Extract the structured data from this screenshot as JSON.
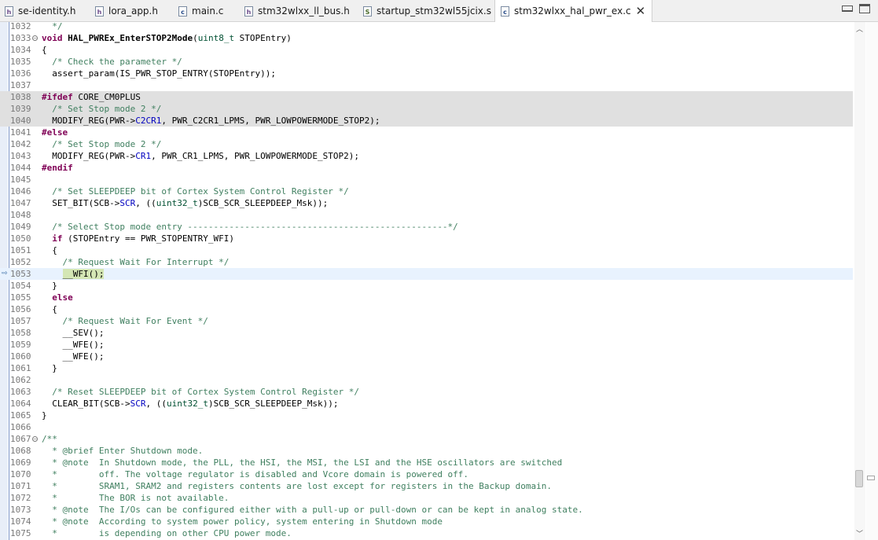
{
  "tabs": [
    {
      "label": "se-identity.h",
      "icon": "h-file-icon",
      "icon_glyph": "h"
    },
    {
      "label": "lora_app.h",
      "icon": "h-file-icon",
      "icon_glyph": "h"
    },
    {
      "label": "main.c",
      "icon": "c-file-icon",
      "icon_glyph": "c"
    },
    {
      "label": "stm32wlxx_ll_bus.h",
      "icon": "h-file-icon",
      "icon_glyph": "h"
    },
    {
      "label": "startup_stm32wl55jcix.s",
      "icon": "s-file-icon",
      "icon_glyph": "S"
    },
    {
      "label": "stm32wlxx_hal_pwr_ex.c",
      "icon": "c-file-icon",
      "icon_glyph": "c",
      "active": true
    }
  ],
  "window": {
    "close_glyph": "✕",
    "minimize_icon": "minimize-icon",
    "maximize_icon": "maximize-icon"
  },
  "lines": [
    {
      "n": "1032",
      "text": "  */"
    },
    {
      "n": "1033",
      "text": "void HAL_PWREx_EnterSTOP2Mode(uint8_t STOPEntry)",
      "fold": true
    },
    {
      "n": "1034",
      "text": "{"
    },
    {
      "n": "1035",
      "text": "  /* Check the parameter */"
    },
    {
      "n": "1036",
      "text": "  assert_param(IS_PWR_STOP_ENTRY(STOPEntry));"
    },
    {
      "n": "1037",
      "text": ""
    },
    {
      "n": "1038",
      "text": "#ifdef CORE_CM0PLUS"
    },
    {
      "n": "1039",
      "text": "  /* Set Stop mode 2 */"
    },
    {
      "n": "1040",
      "text": "  MODIFY_REG(PWR->C2CR1, PWR_C2CR1_LPMS, PWR_LOWPOWERMODE_STOP2);"
    },
    {
      "n": "1041",
      "text": "#else"
    },
    {
      "n": "1042",
      "text": "  /* Set Stop mode 2 */"
    },
    {
      "n": "1043",
      "text": "  MODIFY_REG(PWR->CR1, PWR_CR1_LPMS, PWR_LOWPOWERMODE_STOP2);"
    },
    {
      "n": "1044",
      "text": "#endif"
    },
    {
      "n": "1045",
      "text": ""
    },
    {
      "n": "1046",
      "text": "  /* Set SLEEPDEEP bit of Cortex System Control Register */"
    },
    {
      "n": "1047",
      "text": "  SET_BIT(SCB->SCR, ((uint32_t)SCB_SCR_SLEEPDEEP_Msk));"
    },
    {
      "n": "1048",
      "text": ""
    },
    {
      "n": "1049",
      "text": "  /* Select Stop mode entry --------------------------------------------------*/"
    },
    {
      "n": "1050",
      "text": "  if (STOPEntry == PWR_STOPENTRY_WFI)"
    },
    {
      "n": "1051",
      "text": "  {"
    },
    {
      "n": "1052",
      "text": "    /* Request Wait For Interrupt */"
    },
    {
      "n": "1053",
      "text": "    __WFI();"
    },
    {
      "n": "1054",
      "text": "  }"
    },
    {
      "n": "1055",
      "text": "  else"
    },
    {
      "n": "1056",
      "text": "  {"
    },
    {
      "n": "1057",
      "text": "    /* Request Wait For Event */"
    },
    {
      "n": "1058",
      "text": "    __SEV();"
    },
    {
      "n": "1059",
      "text": "    __WFE();"
    },
    {
      "n": "1060",
      "text": "    __WFE();"
    },
    {
      "n": "1061",
      "text": "  }"
    },
    {
      "n": "1062",
      "text": ""
    },
    {
      "n": "1063",
      "text": "  /* Reset SLEEPDEEP bit of Cortex System Control Register */"
    },
    {
      "n": "1064",
      "text": "  CLEAR_BIT(SCB->SCR, ((uint32_t)SCB_SCR_SLEEPDEEP_Msk));"
    },
    {
      "n": "1065",
      "text": "}"
    },
    {
      "n": "1066",
      "text": ""
    },
    {
      "n": "1067",
      "text": "/**",
      "fold": true
    },
    {
      "n": "1068",
      "text": "  * @brief Enter Shutdown mode."
    },
    {
      "n": "1069",
      "text": "  * @note  In Shutdown mode, the PLL, the HSI, the MSI, the LSI and the HSE oscillators are switched"
    },
    {
      "n": "1070",
      "text": "  *        off. The voltage regulator is disabled and Vcore domain is powered off."
    },
    {
      "n": "1071",
      "text": "  *        SRAM1, SRAM2 and registers contents are lost except for registers in the Backup domain."
    },
    {
      "n": "1072",
      "text": "  *        The BOR is not available."
    },
    {
      "n": "1073",
      "text": "  * @note  The I/Os can be configured either with a pull-up or pull-down or can be kept in analog state."
    },
    {
      "n": "1074",
      "text": "  * @note  According to system power policy, system entering in Shutdown mode"
    },
    {
      "n": "1075",
      "text": "  *        is depending on other CPU power mode."
    }
  ],
  "colors": {
    "comment": "#3f7f5f",
    "keyword": "#7f0055",
    "type": "#005032",
    "field": "#0000c0",
    "inactive_bg": "#e0e0e0",
    "current_line_bg": "#e8f2fe"
  }
}
